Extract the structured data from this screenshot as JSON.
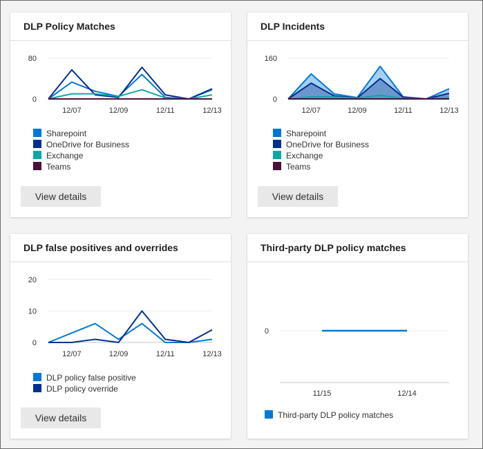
{
  "cards": [
    {
      "title": "DLP Policy Matches",
      "button_label": "View details",
      "chart_data": {
        "type": "line",
        "x": [
          "12/06",
          "12/07",
          "12/08",
          "12/09",
          "12/10",
          "12/11",
          "12/12",
          "12/13"
        ],
        "xticks": [
          "12/07",
          "12/09",
          "12/11",
          "12/13"
        ],
        "yticks": [
          0,
          80
        ],
        "ylim": [
          0,
          80
        ],
        "series": [
          {
            "name": "Sharepoint",
            "color": "#0078d4",
            "values": [
              0,
              33,
              15,
              5,
              48,
              3,
              0,
              18
            ]
          },
          {
            "name": "OneDrive for Business",
            "color": "#002f8f",
            "values": [
              0,
              57,
              8,
              3,
              62,
              8,
              0,
              20
            ]
          },
          {
            "name": "Exchange",
            "color": "#12a5a5",
            "values": [
              0,
              10,
              10,
              5,
              18,
              2,
              0,
              8
            ]
          },
          {
            "name": "Teams",
            "color": "#4b0f3c",
            "values": [
              0,
              0,
              0,
              0,
              0,
              0,
              0,
              0
            ]
          }
        ]
      }
    },
    {
      "title": "DLP Incidents",
      "button_label": "View details",
      "chart_data": {
        "type": "area",
        "x": [
          "12/06",
          "12/07",
          "12/08",
          "12/09",
          "12/10",
          "12/11",
          "12/12",
          "12/13"
        ],
        "xticks": [
          "12/07",
          "12/09",
          "12/11",
          "12/13"
        ],
        "yticks": [
          0,
          160
        ],
        "ylim": [
          0,
          160
        ],
        "series": [
          {
            "name": "Sharepoint",
            "color": "#0078d4",
            "values": [
              0,
              98,
              20,
              5,
              128,
              8,
              0,
              40
            ]
          },
          {
            "name": "OneDrive for Business",
            "color": "#002f8f",
            "values": [
              0,
              62,
              12,
              3,
              80,
              7,
              0,
              22
            ]
          },
          {
            "name": "Exchange",
            "color": "#12a5a5",
            "values": [
              0,
              8,
              8,
              3,
              15,
              2,
              0,
              5
            ]
          },
          {
            "name": "Teams",
            "color": "#4b0f3c",
            "values": [
              0,
              0,
              0,
              0,
              0,
              0,
              0,
              0
            ]
          }
        ]
      }
    },
    {
      "title": "DLP false positives and overrides",
      "button_label": "View details",
      "chart_data": {
        "type": "line",
        "x": [
          "12/06",
          "12/07",
          "12/08",
          "12/09",
          "12/10",
          "12/11",
          "12/12",
          "12/13"
        ],
        "xticks": [
          "12/07",
          "12/09",
          "12/11",
          "12/13"
        ],
        "yticks": [
          0,
          10,
          20
        ],
        "ylim": [
          0,
          20
        ],
        "series": [
          {
            "name": "DLP policy false positive",
            "color": "#0078d4",
            "values": [
              0,
              3,
              6,
              1,
              6,
              0,
              0,
              1
            ]
          },
          {
            "name": "DLP policy override",
            "color": "#002f8f",
            "values": [
              0,
              0,
              1,
              0,
              10,
              1,
              0,
              4
            ]
          }
        ]
      }
    },
    {
      "title": "Third-party DLP policy matches",
      "chart_data": {
        "type": "line",
        "x": [
          "11/15",
          "12/14"
        ],
        "xticks": [
          "11/15",
          "12/14"
        ],
        "yticks": [
          0
        ],
        "ylim": [
          0,
          1
        ],
        "series": [
          {
            "name": "Third-party DLP policy matches",
            "color": "#0078d4",
            "values": [
              0,
              0
            ]
          }
        ]
      }
    }
  ]
}
